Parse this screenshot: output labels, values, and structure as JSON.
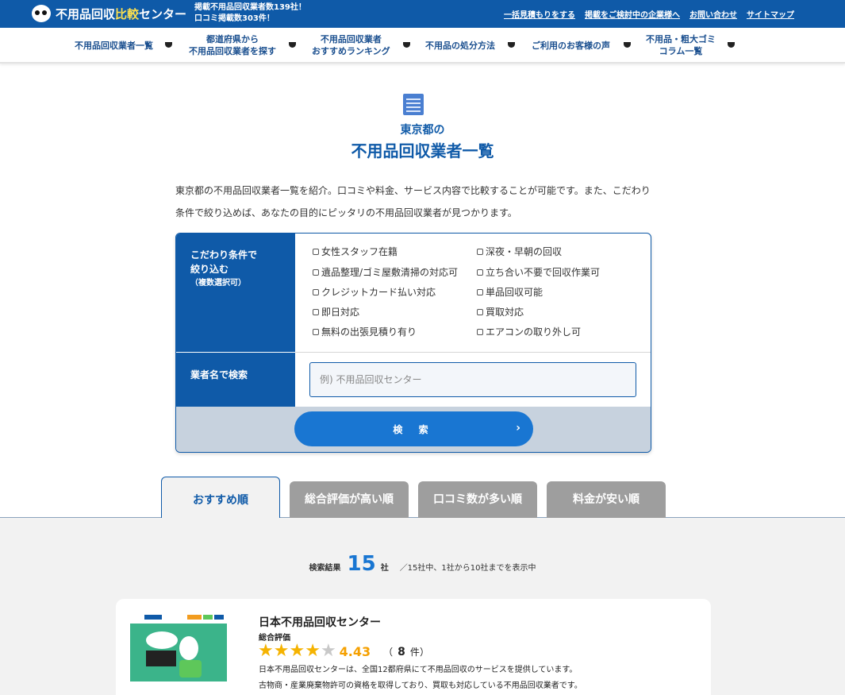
{
  "header": {
    "logo_text_a": "不用品回収",
    "logo_text_b": "比較",
    "logo_text_c": "センター",
    "stats_line1": "掲載不用品回収業者数139社！",
    "stats_line2": "口コミ掲載数303件！",
    "links": [
      "一括見積もりをする",
      "掲載をご検討中の企業様へ",
      "お問い合わせ",
      "サイトマップ"
    ]
  },
  "nav": {
    "items": [
      {
        "line1": "不用品回収業者一覧",
        "line2": ""
      },
      {
        "line1": "都道府県から",
        "line2": "不用品回収業者を探す"
      },
      {
        "line1": "不用品回収業者",
        "line2": "おすすめランキング"
      },
      {
        "line1": "不用品の処分方法",
        "line2": ""
      },
      {
        "line1": "ご利用のお客様の声",
        "line2": ""
      },
      {
        "line1": "不用品・粗大ゴミ",
        "line2": "コラム一覧"
      }
    ]
  },
  "heading": {
    "sub": "東京都の",
    "main": "不用品回収業者一覧"
  },
  "description": "東京都の不用品回収業者一覧を紹介。口コミや料金、サービス内容で比較することが可能です。また、こだわり条件で絞り込めば、あなたの目的にピッタリの不用品回収業者が見つかります。",
  "filter": {
    "label_line1": "こだわり条件で",
    "label_line2": "絞り込む",
    "label_note": "（複数選択可）",
    "options": [
      "女性スタッフ在籍",
      "深夜・早朝の回収",
      "遺品整理/ゴミ屋敷清掃の対応可",
      "立ち合い不要で回収作業可",
      "クレジットカード払い対応",
      "単品回収可能",
      "即日対応",
      "買取対応",
      "無料の出張見積り有り",
      "エアコンの取り外し可"
    ],
    "name_label": "業者名で検索",
    "name_placeholder": "例) 不用品回収センター",
    "search_label": "検 索",
    "search_chevron": "›"
  },
  "tabs": [
    "おすすめ順",
    "総合評価が高い順",
    "口コミ数が多い順",
    "料金が安い順"
  ],
  "results": {
    "label": "検索結果",
    "count": "15",
    "unit": "社",
    "note": "／15社中、1社から10社までを表示中"
  },
  "card": {
    "name": "日本不用品回収センター",
    "rating_label": "総合評価",
    "rating": 4.43,
    "rating_text": "4.43",
    "review_open": "（",
    "review_count": "8",
    "review_unit": "件",
    "review_close": "）",
    "desc_line1": "日本不用品回収センターは、全国12都府県にて不用品回収のサービスを提供しています。",
    "desc_line2": "古物商・産業廃棄物許可の資格を取得しており、買取も対応している不用品回収業者です。"
  },
  "colors": {
    "brand": "#0f5aa8",
    "accent": "#1976d2",
    "star": "#f5b301"
  }
}
